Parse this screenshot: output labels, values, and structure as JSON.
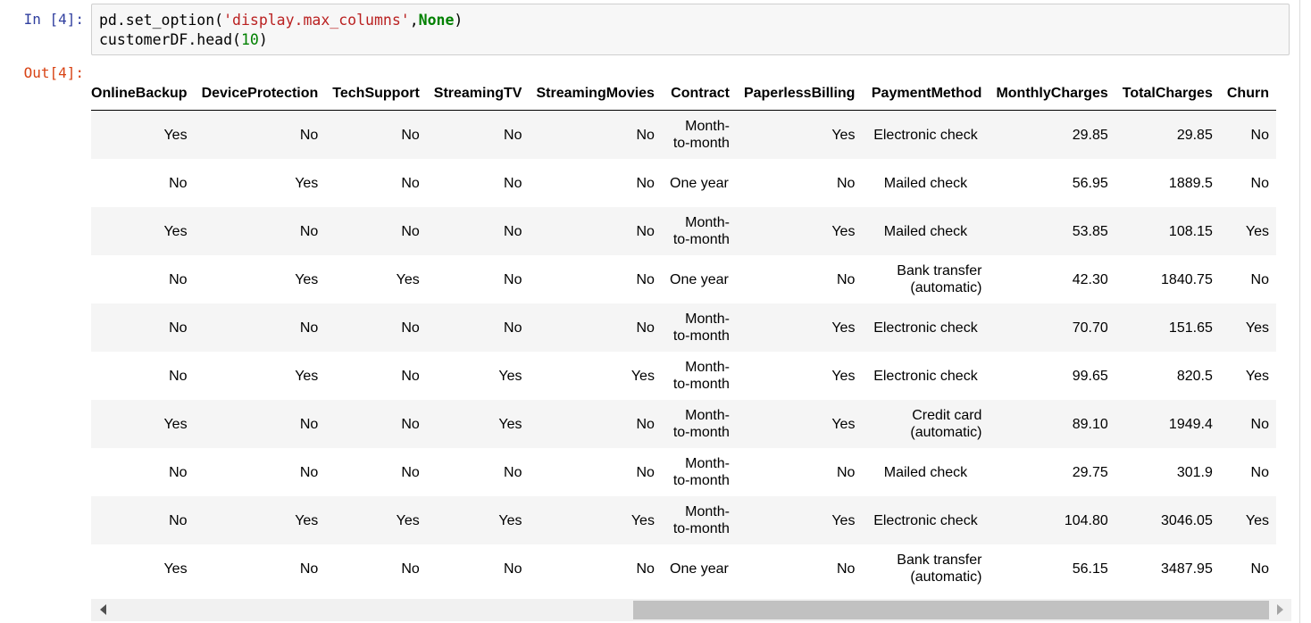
{
  "cell": {
    "in_prompt": "In [4]:",
    "out_prompt": "Out[4]:",
    "code": {
      "line1": {
        "fn": "pd.set_option(",
        "arg": "'display.max_columns'",
        "comma": ",",
        "kw": "None",
        "close": ")"
      },
      "line2": {
        "fn": "customerDF.head(",
        "arg": "10",
        "close": ")"
      }
    }
  },
  "table": {
    "columns": [
      "OnlineBackup",
      "DeviceProtection",
      "TechSupport",
      "StreamingTV",
      "StreamingMovies",
      "Contract",
      "PaperlessBilling",
      "PaymentMethod",
      "MonthlyCharges",
      "TotalCharges",
      "Churn"
    ],
    "rows": [
      [
        "Yes",
        "No",
        "No",
        "No",
        "No",
        "Month-to-month",
        "Yes",
        "Electronic check",
        "29.85",
        "29.85",
        "No"
      ],
      [
        "No",
        "Yes",
        "No",
        "No",
        "No",
        "One year",
        "No",
        "Mailed check",
        "56.95",
        "1889.5",
        "No"
      ],
      [
        "Yes",
        "No",
        "No",
        "No",
        "No",
        "Month-to-month",
        "Yes",
        "Mailed check",
        "53.85",
        "108.15",
        "Yes"
      ],
      [
        "No",
        "Yes",
        "Yes",
        "No",
        "No",
        "One year",
        "No",
        "Bank transfer (automatic)",
        "42.30",
        "1840.75",
        "No"
      ],
      [
        "No",
        "No",
        "No",
        "No",
        "No",
        "Month-to-month",
        "Yes",
        "Electronic check",
        "70.70",
        "151.65",
        "Yes"
      ],
      [
        "No",
        "Yes",
        "No",
        "Yes",
        "Yes",
        "Month-to-month",
        "Yes",
        "Electronic check",
        "99.65",
        "820.5",
        "Yes"
      ],
      [
        "Yes",
        "No",
        "No",
        "Yes",
        "No",
        "Month-to-month",
        "Yes",
        "Credit card (automatic)",
        "89.10",
        "1949.4",
        "No"
      ],
      [
        "No",
        "No",
        "No",
        "No",
        "No",
        "Month-to-month",
        "No",
        "Mailed check",
        "29.75",
        "301.9",
        "No"
      ],
      [
        "No",
        "Yes",
        "Yes",
        "Yes",
        "Yes",
        "Month-to-month",
        "Yes",
        "Electronic check",
        "104.80",
        "3046.05",
        "Yes"
      ],
      [
        "Yes",
        "No",
        "No",
        "No",
        "No",
        "One year",
        "No",
        "Bank transfer (automatic)",
        "56.15",
        "3487.95",
        "No"
      ]
    ]
  },
  "scrollbar": {
    "left_icon": "scroll-left-arrow-icon",
    "right_icon": "scroll-right-arrow-icon"
  }
}
